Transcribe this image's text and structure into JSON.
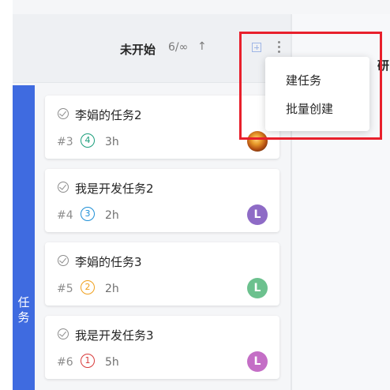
{
  "column": {
    "title": "未开始",
    "count": "6/∞",
    "sort_arrow": "↑"
  },
  "next_column": {
    "title_partial": "研"
  },
  "swimlane": {
    "label_line1": "任",
    "label_line2": "务"
  },
  "cards": [
    {
      "title": "李娟的任务2",
      "number": "#3",
      "priority": "4",
      "priority_color": "#1a9e7b",
      "hours": "3h",
      "avatar": "",
      "avatar_color": ""
    },
    {
      "title": "我是开发任务2",
      "number": "#4",
      "priority": "3",
      "priority_color": "#1e8fd6",
      "hours": "2h",
      "avatar": "L",
      "avatar_color": "#8e6bc6"
    },
    {
      "title": "李娟的任务3",
      "number": "#5",
      "priority": "2",
      "priority_color": "#f0a01d",
      "hours": "2h",
      "avatar": "L",
      "avatar_color": "#6cc18e"
    },
    {
      "title": "我是开发任务3",
      "number": "#6",
      "priority": "1",
      "priority_color": "#d83a3a",
      "hours": "5h",
      "avatar": "L",
      "avatar_color": "#c46ec6"
    }
  ],
  "menu": {
    "items": [
      "建任务",
      "批量创建"
    ]
  },
  "colors": {
    "accent": "#3f6be0",
    "highlight": "#e8202c"
  }
}
